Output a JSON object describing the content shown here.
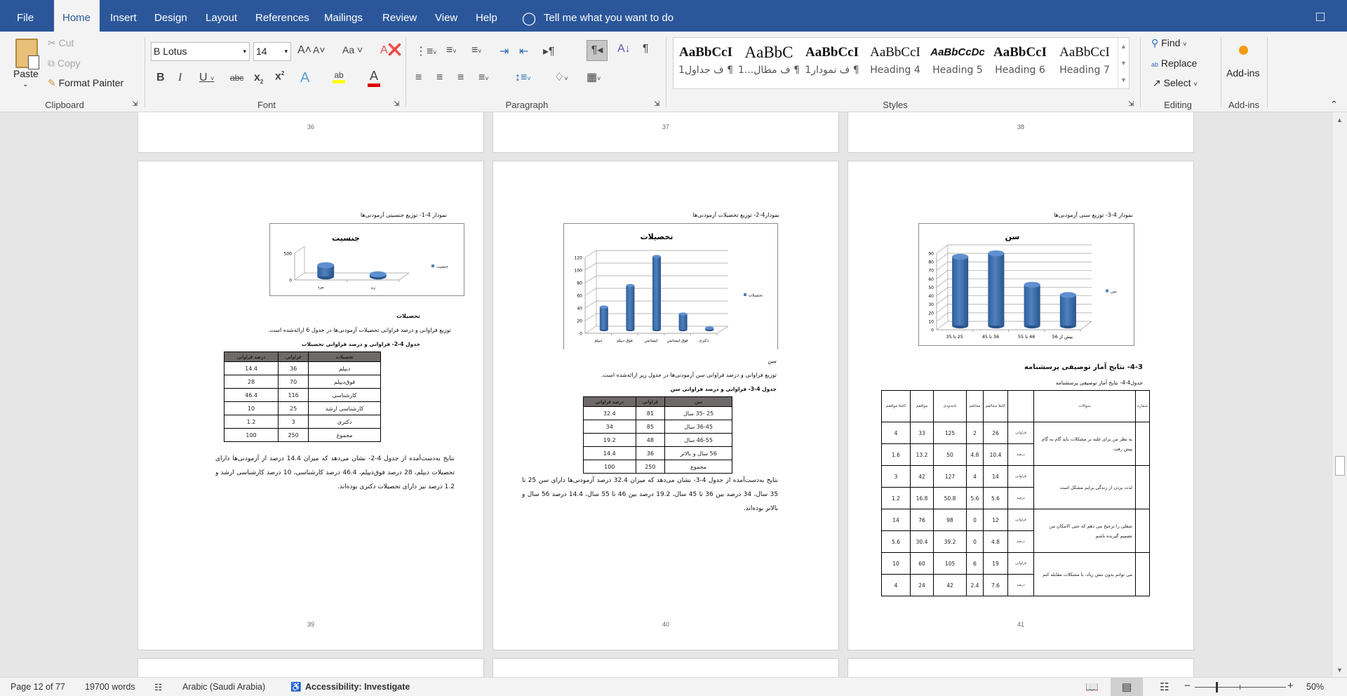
{
  "tabs": [
    "File",
    "Home",
    "Insert",
    "Design",
    "Layout",
    "References",
    "Mailings",
    "Review",
    "View",
    "Help"
  ],
  "active_tab": "Home",
  "tell_me": "Tell me what you want to do",
  "clipboard": {
    "paste": "Paste",
    "cut": "Cut",
    "copy": "Copy",
    "format_painter": "Format Painter",
    "label": "Clipboard"
  },
  "font": {
    "name": "B Lotus",
    "size": "14",
    "label": "Font",
    "font_color": "#e00000",
    "highlight_color": "#ffff00"
  },
  "paragraph": {
    "label": "Paragraph"
  },
  "styles": {
    "label": "Styles",
    "items": [
      {
        "sample": "AaBbCcI",
        "name": "ف جداول1 ¶"
      },
      {
        "sample": "AaBbC",
        "name": "ف مطال...1 ¶"
      },
      {
        "sample": "AaBbCcI",
        "name": "ف نمودار1 ¶"
      },
      {
        "sample": "AaBbCcI",
        "name": "Heading 4"
      },
      {
        "sample": "AaBbCcDc",
        "name": "Heading 5"
      },
      {
        "sample": "AaBbCcI",
        "name": "Heading 6"
      },
      {
        "sample": "AaBbCcI",
        "name": "Heading 7"
      }
    ]
  },
  "editing": {
    "find": "Find",
    "replace": "Replace",
    "select": "Select",
    "label": "Editing"
  },
  "addins": {
    "button": "Add-ins",
    "label": "Add-ins"
  },
  "pages_top": [
    "36",
    "37",
    "38"
  ],
  "page39": {
    "number": "39",
    "chart_caption": "نمودار 4-1- توزیع جنسیتی آزمودنی‌ها",
    "heading": "تحصیلات",
    "intro": "توزیع فراوانی و درصد فراوانی تحصیلات آزمودنی‌ها در جدول 6 ارائه‌شده است.",
    "table_caption": "جدول 4-2- فراوانی و درصد فراوانی تحصیلات",
    "table": {
      "headers": [
        "تحصیلات",
        "فراوانی",
        "درصد فراوانی"
      ],
      "rows": [
        [
          "دیپلم",
          "36",
          "14.4"
        ],
        [
          "فوق‌دیپلم",
          "70",
          "28"
        ],
        [
          "کارشناسی",
          "116",
          "46.4"
        ],
        [
          "کارشناسی ارشد",
          "25",
          "10"
        ],
        [
          "دکتری",
          "3",
          "1.2"
        ],
        [
          "مجموع",
          "250",
          "100"
        ]
      ]
    },
    "conclusion": "نتایج به‌دست‌آمده از جدول 4-2- نشان می‌دهد که میزان 14.4 درصد از آزمودنی‌ها دارای تحصیلات دیپلم، 28 درصد فوق‌دیپلم، 46.4 درصد کارشناسی، 10 درصد کارشناسی ارشد و 1.2 درصد نیز دارای تحصیلات دکتری بوده‌اند."
  },
  "page40": {
    "number": "40",
    "chart_caption": "نمودار4-2- توزیع تحصیلات آزمودنی‌ها",
    "heading": "سن",
    "intro": "توزیع فراوانی و درصد فراوانی سن آزمودنی‌ها در جدول زیر ارائه‌شده است.",
    "table_caption": "جدول 4-3- فراوانی و درصد فراوانی سن",
    "table": {
      "headers": [
        "سن",
        "فراوانی",
        "درصد فراوانی"
      ],
      "rows": [
        [
          "25 -35 سال",
          "81",
          "32.4"
        ],
        [
          "36-45 سال",
          "85",
          "34"
        ],
        [
          "46-55 سال",
          "48",
          "19.2"
        ],
        [
          "56 سال و بالاتر",
          "36",
          "14.4"
        ],
        [
          "مجموع",
          "250",
          "100"
        ]
      ]
    },
    "conclusion": "نتایج به‌دست‌آمده از جدول 4-3- نشان می‌دهد که میزان 32.4 درصد آزمودنی‌ها دارای سن 25 تا 35 سال، 34 درصد بین 36 تا 45 سال، 19.2 درصد بین 46 تا 55 سال، 14.4 درصد 56 سال و بالاتر بوده‌اند."
  },
  "page41": {
    "number": "41",
    "chart_caption": "نمودار 4-3- توزیع سنی آزمودنی‌ها",
    "heading": "4-3- نتایج آمار توصیفی پرسشنامه",
    "table_caption": "جدول4-4- نتایج آمار توصیفی پرسشنامه",
    "table": {
      "headers": [
        "شماره",
        "سوالات",
        "",
        "کاملا مخالفم",
        "مخالفم",
        "تاحدودی",
        "موافقم",
        "کاملا موافقم"
      ],
      "questions": [
        {
          "text": "به نظر من برای غلبه بر مشکلات باید گام به گام پیش رفت",
          "freq": [
            "فراوانی",
            "26",
            "2",
            "125",
            "33",
            "4"
          ],
          "pct": [
            "درصد",
            "10.4",
            "4.8",
            "50",
            "13.2",
            "1.6"
          ]
        },
        {
          "text": "لذت بردن از زندگی برایم مشکل است",
          "freq": [
            "فراوانی",
            "14",
            "4",
            "127",
            "42",
            "3"
          ],
          "pct": [
            "درصد",
            "5.6",
            "5.6",
            "50.8",
            "16.8",
            "1.2"
          ]
        },
        {
          "text": "شغلی را ترجیح می دهم که حتی الامکان من تصمیم گیرنده باشم",
          "freq": [
            "فراوانی",
            "12",
            "0",
            "98",
            "76",
            "14"
          ],
          "pct": [
            "درصد",
            "4.8",
            "0",
            "39.2",
            "30.4",
            "5.6"
          ]
        },
        {
          "text": "می توانم بدون تنش زیاد، با مشکلات مقابله کنم",
          "freq": [
            "فراوانی",
            "19",
            "6",
            "105",
            "60",
            "10"
          ],
          "pct": [
            "درصد",
            "7.6",
            "2.4",
            "42",
            "24",
            "4"
          ]
        }
      ]
    }
  },
  "chart_data": [
    {
      "type": "bar",
      "title": "جنسیت",
      "categories": [
        "مرد",
        "زن"
      ],
      "series": [
        {
          "name": "جنسیت",
          "values": [
            210,
            40
          ]
        }
      ],
      "ylim": [
        0,
        500
      ],
      "yticks": [
        0,
        500
      ],
      "legend": "right",
      "grid": false,
      "color": "#4f81bd"
    },
    {
      "type": "bar",
      "title": "تحصیلات",
      "categories": [
        "دیپلم",
        "فوق دیپلم",
        "لیسانس",
        "فوق لیسانس",
        "دکتری"
      ],
      "series": [
        {
          "name": "تحصیلات",
          "values": [
            36,
            70,
            116,
            25,
            3
          ]
        }
      ],
      "ylim": [
        0,
        120
      ],
      "yticks": [
        0,
        20,
        40,
        60,
        80,
        100,
        120
      ],
      "legend": "right",
      "grid": true,
      "color": "#4f81bd"
    },
    {
      "type": "bar",
      "title": "سن",
      "categories": [
        "25 تا 35",
        "36 تا 45",
        "46 تا 55",
        "بیش از 56"
      ],
      "series": [
        {
          "name": "سن",
          "values": [
            81,
            85,
            48,
            36
          ]
        }
      ],
      "ylim": [
        0,
        90
      ],
      "yticks": [
        0,
        10,
        20,
        30,
        40,
        50,
        60,
        70,
        80,
        90
      ],
      "legend": "right",
      "grid": true,
      "color": "#4f81bd"
    }
  ],
  "status": {
    "page": "Page 12 of 77",
    "words": "19700 words",
    "language": "Arabic (Saudi Arabia)",
    "accessibility": "Accessibility: Investigate",
    "zoom": "50%",
    "zoom_level_percent": 50
  }
}
